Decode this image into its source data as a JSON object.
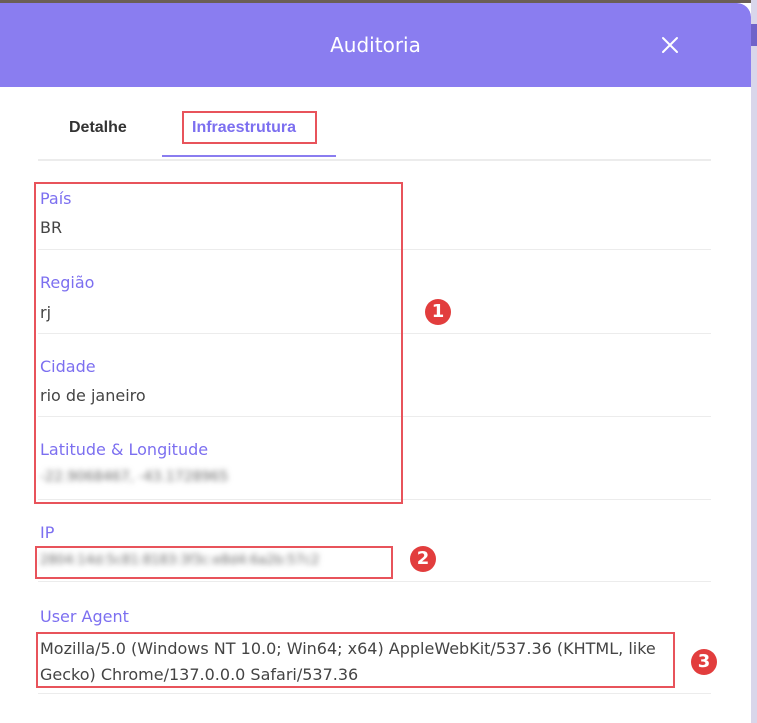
{
  "modal": {
    "title": "Auditoria"
  },
  "tabs": [
    {
      "label": "Detalhe"
    },
    {
      "label": "Infraestrutura"
    }
  ],
  "fields": {
    "pais": {
      "label": "País",
      "value": "BR"
    },
    "regiao": {
      "label": "Região",
      "value": "rj"
    },
    "cidade": {
      "label": "Cidade",
      "value": "rio de janeiro"
    },
    "latlong": {
      "label": "Latitude & Longitude",
      "value": "-22.9068467, -43.1728965"
    },
    "ip": {
      "label": "IP",
      "value": "2804:14d:5c81:8183:3f3c:e8d4:6a2b:57c2"
    },
    "user_agent": {
      "label": "User Agent",
      "value": "Mozilla/5.0 (Windows NT 10.0; Win64; x64) AppleWebKit/537.36 (KHTML, like Gecko) Chrome/137.0.0.0 Safari/537.36"
    }
  },
  "annotations": {
    "badge1": "1",
    "badge2": "2",
    "badge3": "3"
  },
  "colors": {
    "header": "#8a7df0",
    "accent": "#7c6ff0",
    "highlight": "#e8535b",
    "badge": "#e23d3d"
  },
  "icons": {
    "close": "close-icon"
  }
}
